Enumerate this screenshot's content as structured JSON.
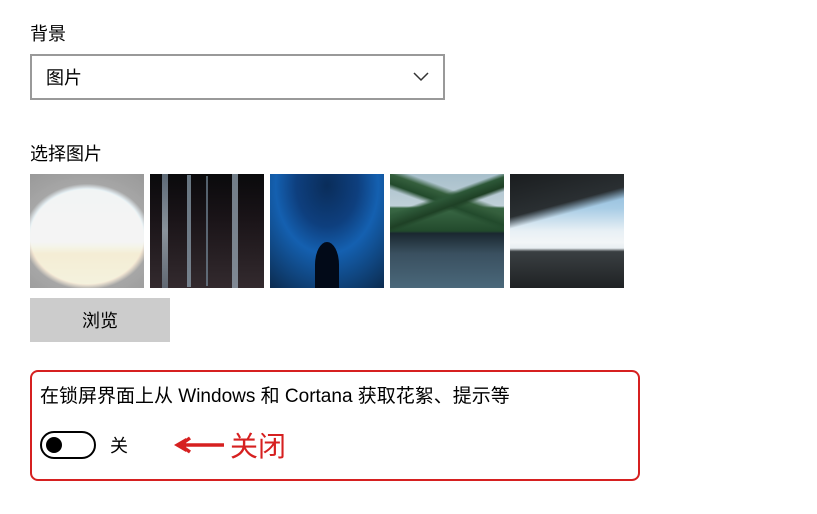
{
  "background": {
    "label": "背景",
    "dropdown_value": "图片"
  },
  "picture_select": {
    "label": "选择图片",
    "browse_button": "浏览",
    "thumbnails": [
      {
        "name": "cave-beach",
        "selected": true
      },
      {
        "name": "waterfall-rocks",
        "selected": false
      },
      {
        "name": "ice-cave-blue",
        "selected": false
      },
      {
        "name": "mountain-lake",
        "selected": false
      },
      {
        "name": "hillside-clouds",
        "selected": false
      }
    ]
  },
  "tips_setting": {
    "description": "在锁屏界面上从 Windows 和 Cortana 获取花絮、提示等",
    "state_label": "关",
    "state": "off"
  },
  "annotation": {
    "text": "关闭",
    "color": "#d62020"
  }
}
